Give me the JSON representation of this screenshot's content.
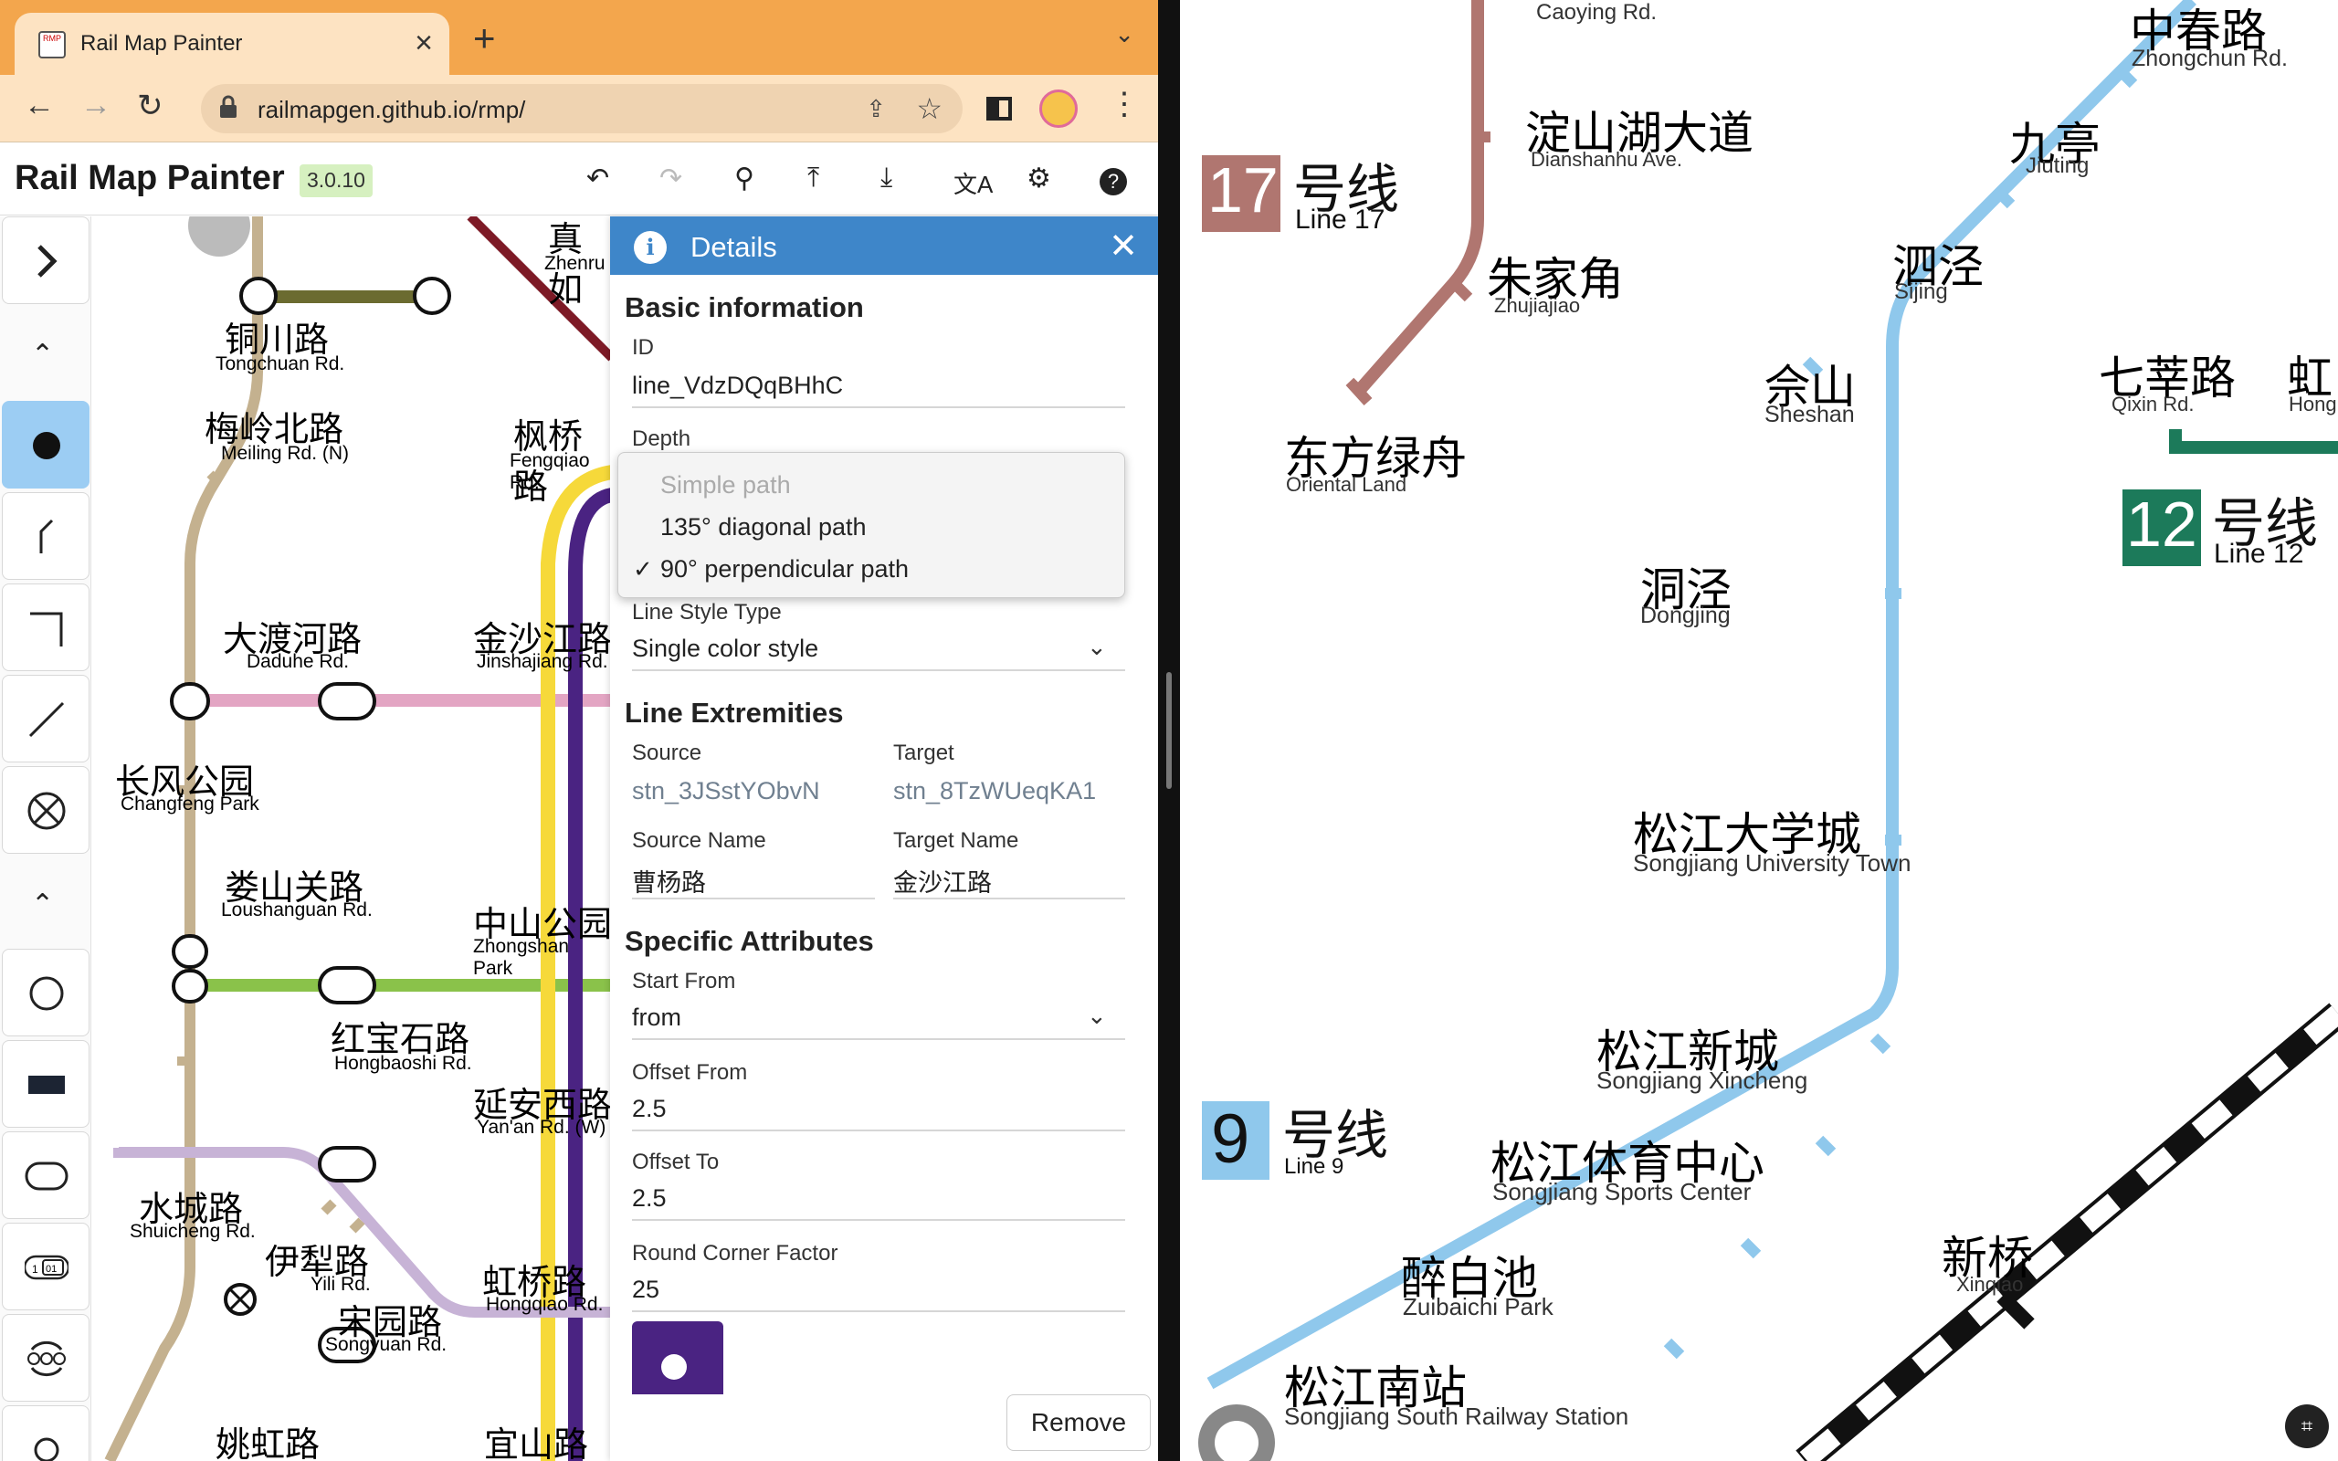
{
  "browser": {
    "tab_title": "Rail Map Painter",
    "favicon_text": "RMP",
    "url": "railmapgen.github.io/rmp/"
  },
  "app": {
    "title": "Rail Map Painter",
    "version": "3.0.10"
  },
  "details": {
    "header": "Details",
    "basic_info": "Basic information",
    "id_label": "ID",
    "id_value": "line_VdzDQqBHhC",
    "depth_label": "Depth",
    "dropdown_options": [
      "Simple path",
      "135° diagonal path",
      "90° perpendicular path"
    ],
    "dropdown_selected": "90° perpendicular path",
    "line_style_label": "Line Style Type",
    "line_style_value": "Single color style",
    "extremities": "Line Extremities",
    "source_label": "Source",
    "source_value": "stn_3JSstYObvN",
    "target_label": "Target",
    "target_value": "stn_8TzWUeqKA1",
    "source_name_label": "Source Name",
    "source_name_value": "曹杨路",
    "target_name_label": "Target Name",
    "target_name_value": "金沙江路",
    "specific": "Specific Attributes",
    "start_from_label": "Start From",
    "start_from_value": "from",
    "offset_from_label": "Offset From",
    "offset_from_value": "2.5",
    "offset_to_label": "Offset To",
    "offset_to_value": "2.5",
    "round_corner_label": "Round Corner Factor",
    "round_corner_value": "25",
    "color": "#4a2382",
    "remove": "Remove"
  },
  "left_map": {
    "stations": [
      {
        "zh": "铜川路",
        "en": "Tongchuan Rd."
      },
      {
        "zh": "真如",
        "en": "Zhenru"
      },
      {
        "zh": "梅岭北路",
        "en": "Meiling Rd. (N)"
      },
      {
        "zh": "枫桥路",
        "en": "Fengqiao Rd."
      },
      {
        "zh": "大渡河路",
        "en": "Daduhe Rd."
      },
      {
        "zh": "金沙江路",
        "en": "Jinshajiang Rd."
      },
      {
        "zh": "长风公园",
        "en": "Changfeng Park"
      },
      {
        "zh": "娄山关路",
        "en": "Loushanguan Rd."
      },
      {
        "zh": "中山公园",
        "en": "Zhongshan Park"
      },
      {
        "zh": "红宝石路",
        "en": "Hongbaoshi Rd."
      },
      {
        "zh": "延安西路",
        "en": "Yan'an Rd. (W)"
      },
      {
        "zh": "水城路",
        "en": "Shuicheng Rd."
      },
      {
        "zh": "伊犁路",
        "en": "Yili Rd."
      },
      {
        "zh": "虹桥路",
        "en": "Hongqiao Rd."
      },
      {
        "zh": "宋园路",
        "en": "Songyuan Rd."
      },
      {
        "zh": "姚虹路",
        "en": ""
      },
      {
        "zh": "宜山路",
        "en": ""
      }
    ]
  },
  "right_map": {
    "line_badges": [
      {
        "num": "17",
        "zh": "号线",
        "en": "Line 17",
        "color": "#b07670"
      },
      {
        "num": "12",
        "zh": "号线",
        "en": "Line 12",
        "color": "#1c7a5a"
      },
      {
        "num": "9",
        "zh": "号线",
        "en": "Line 9",
        "color": "#8fc8ec"
      }
    ],
    "stations": [
      {
        "zh": "",
        "en": "Caoying Rd."
      },
      {
        "zh": "中春路",
        "en": "Zhongchun Rd."
      },
      {
        "zh": "淀山湖大道",
        "en": "Dianshanhu Ave."
      },
      {
        "zh": "九亭",
        "en": "Jiuting"
      },
      {
        "zh": "朱家角",
        "en": "Zhujiajiao"
      },
      {
        "zh": "泗泾",
        "en": "Sijing"
      },
      {
        "zh": "佘山",
        "en": "Sheshan"
      },
      {
        "zh": "七莘路",
        "en": "Qixin Rd."
      },
      {
        "zh": "虹",
        "en": "Hong"
      },
      {
        "zh": "东方绿舟",
        "en": "Oriental Land"
      },
      {
        "zh": "洞泾",
        "en": "Dongjing"
      },
      {
        "zh": "松江大学城",
        "en": "Songjiang University Town"
      },
      {
        "zh": "松江新城",
        "en": "Songjiang Xincheng"
      },
      {
        "zh": "松江体育中心",
        "en": "Songjiang Sports Center"
      },
      {
        "zh": "新桥",
        "en": "Xinqiao"
      },
      {
        "zh": "醉白池",
        "en": "Zuibaichi Park"
      },
      {
        "zh": "松江南站",
        "en": "Songjiang South Railway Station"
      }
    ]
  }
}
